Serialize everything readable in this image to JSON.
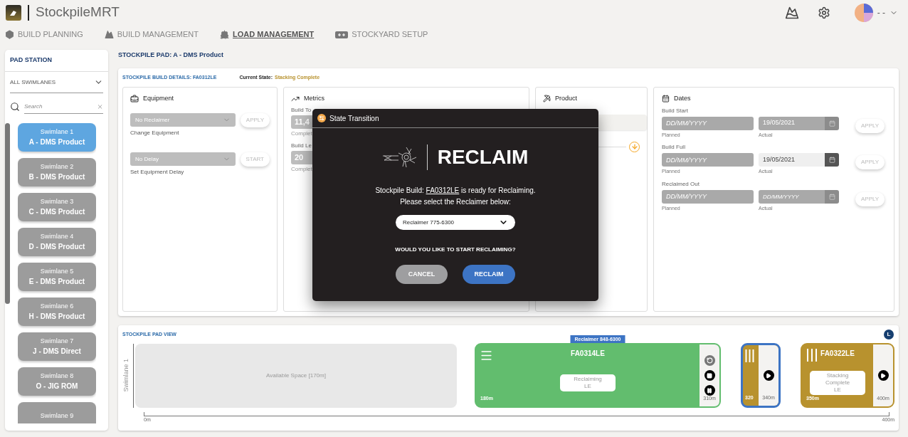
{
  "app": {
    "title": "StockpileMRT",
    "user": "- -"
  },
  "nav": [
    {
      "label": "BUILD PLANNING",
      "selected": false
    },
    {
      "label": "BUILD MANAGEMENT",
      "selected": false
    },
    {
      "label": "LOAD MANAGEMENT",
      "selected": true
    },
    {
      "label": "STOCKYARD SETUP",
      "selected": false
    }
  ],
  "sidebar": {
    "title": "PAD STATION",
    "filter": "ALL SWIMLANES",
    "search_placeholder": "Search",
    "swimlanes": [
      {
        "number": "Swimlane 1",
        "name": "A - DMS Product",
        "selected": true
      },
      {
        "number": "Swimlane 2",
        "name": "B - DMS Product",
        "selected": false
      },
      {
        "number": "Swimlane 3",
        "name": "C - DMS Product",
        "selected": false
      },
      {
        "number": "Swimlane 4",
        "name": "D - DMS Product",
        "selected": false
      },
      {
        "number": "Swimlane 5",
        "name": "E - DMS Product",
        "selected": false
      },
      {
        "number": "Swimlane 6",
        "name": "H - DMS Product",
        "selected": false
      },
      {
        "number": "Swimlane 7",
        "name": "J - DMS Direct",
        "selected": false
      },
      {
        "number": "Swimlane 8",
        "name": "O - JIG ROM",
        "selected": false
      },
      {
        "number": "Swimlane 9",
        "selected": false
      }
    ]
  },
  "pad": {
    "title": "STOCKPILE PAD: A - DMS Product"
  },
  "build_details": {
    "title": "STOCKPILE BUILD DETAILS: FA0312LE",
    "state_label": "Current State:",
    "state": "Stacking Complete",
    "equipment": {
      "title": "Equipment",
      "rows": [
        {
          "value": "No Reclaimer",
          "button": "APPLY",
          "caption": "Change Equipment"
        },
        {
          "value": "No Delay",
          "button": "START",
          "caption": "Set Equipment Delay"
        }
      ]
    },
    "metrics": {
      "title": "Metrics",
      "fields": [
        {
          "label": "Build To",
          "value": "11,4",
          "caption": "Complet"
        },
        {
          "label": "Build Le",
          "value": "20",
          "caption": "Complet"
        }
      ]
    },
    "product": {
      "title": "Product"
    },
    "dates": {
      "title": "Dates",
      "rows": [
        {
          "label": "Build Start",
          "planned_placeholder": "DD/MM/YYYY",
          "planned_caption": "Planned",
          "actual": "19/05/2021",
          "actual_caption": "Actual",
          "disabled": true,
          "button": "APPLY"
        },
        {
          "label": "Build Full",
          "planned_placeholder": "DD/MM/YYYY",
          "planned_caption": "Planned",
          "actual": "19/05/2021",
          "actual_caption": "Actual",
          "disabled": false,
          "button": "APPLY"
        },
        {
          "label": "Reclaimed Out",
          "planned_placeholder": "DD/MM/YYYY",
          "planned_caption": "Planned",
          "actual_placeholder": "DD/MM/YYYY",
          "actual_caption": "Actual",
          "disabled": true,
          "button": "APPLY"
        }
      ]
    }
  },
  "pad_view": {
    "title": "STOCKPILE PAD VIEW",
    "badge": "L",
    "lane": "Swimlane 1",
    "axis_start": "0m",
    "axis_end": "400m",
    "blocks": [
      {
        "kind": "space",
        "label": "Available Space [170m]"
      },
      {
        "kind": "build",
        "equipment": "Reclaimer 848-6300",
        "id": "FA0314LE",
        "status": [
          "Reclaiming",
          "LE"
        ],
        "start": "180m",
        "end": "310m",
        "color": "#62bd6e",
        "running": true,
        "selected": false
      },
      {
        "kind": "build",
        "start": "320",
        "end": "340m",
        "color": "#b8922e",
        "running": false,
        "selected": true
      },
      {
        "kind": "build",
        "id": "FA0322LE",
        "status": [
          "Stacking",
          "Complete",
          "LE"
        ],
        "start": "350m",
        "end": "400m",
        "color": "#b8922e",
        "running": false,
        "selected": false
      }
    ]
  },
  "dialog": {
    "title": "State Transition",
    "heading": "RECLAIM",
    "message_prefix": "Stockpile Build: ",
    "build": "FA0312LE",
    "message_suffix": " is ready for Reclaiming.",
    "message_line2": "Please select the Reclaimer below:",
    "reclaimer": "Reclaimer 775-6300",
    "question": "WOULD YOU LIKE TO START RECLAIMING?",
    "cancel": "CANCEL",
    "confirm": "RECLAIM"
  }
}
